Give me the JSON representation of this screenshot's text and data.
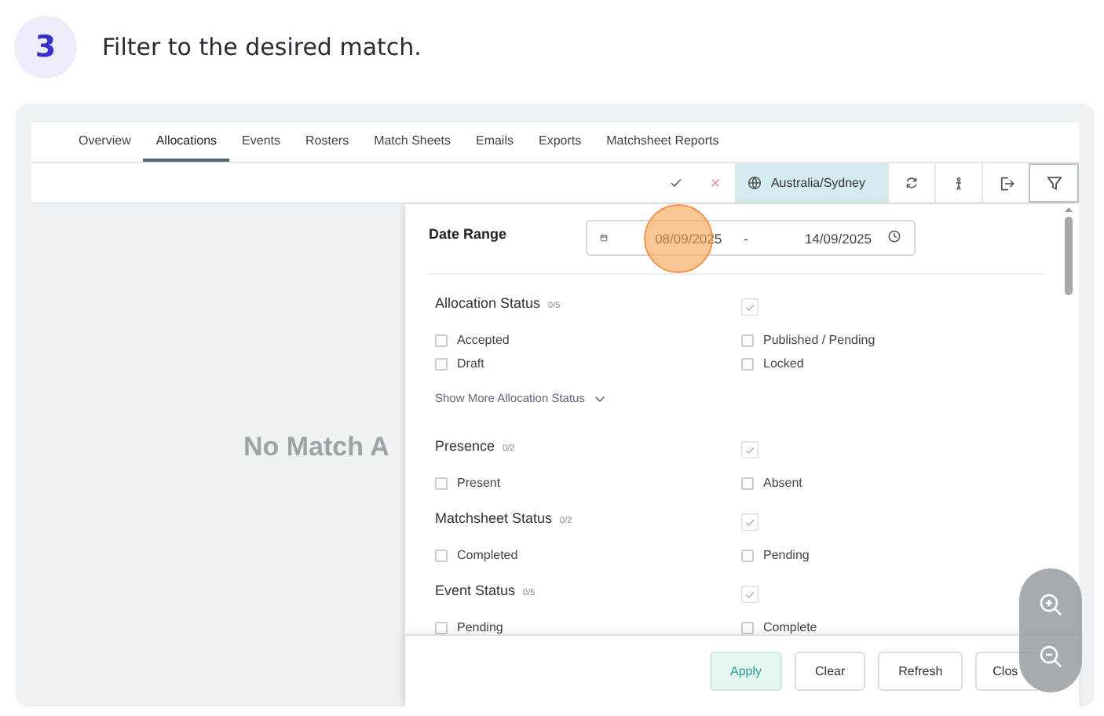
{
  "step": {
    "number": "3",
    "instruction": "Filter to the desired match."
  },
  "tabs": [
    {
      "label": "Overview",
      "selected": false
    },
    {
      "label": "Allocations",
      "selected": true
    },
    {
      "label": "Events",
      "selected": false
    },
    {
      "label": "Rosters",
      "selected": false
    },
    {
      "label": "Match Sheets",
      "selected": false
    },
    {
      "label": "Emails",
      "selected": false
    },
    {
      "label": "Exports",
      "selected": false
    },
    {
      "label": "Matchsheet Reports",
      "selected": false
    }
  ],
  "toolbar": {
    "timezone": "Australia/Sydney",
    "filter_active": true
  },
  "empty_message": "No Match A",
  "filter": {
    "date_range": {
      "label": "Date Range",
      "from": "08/09/2025",
      "separator": "-",
      "to": "14/09/2025"
    },
    "sections": [
      {
        "title": "Allocation Status",
        "count": "0/5",
        "options": [
          {
            "label": "Accepted",
            "checked": false
          },
          {
            "label": "Published / Pending",
            "checked": false
          },
          {
            "label": "Draft",
            "checked": false
          },
          {
            "label": "Locked",
            "checked": false
          }
        ],
        "more_link": "Show More Allocation Status"
      },
      {
        "title": "Presence",
        "count": "0/2",
        "options": [
          {
            "label": "Present",
            "checked": false
          },
          {
            "label": "Absent",
            "checked": false
          }
        ]
      },
      {
        "title": "Matchsheet Status",
        "count": "0/2",
        "options": [
          {
            "label": "Completed",
            "checked": false
          },
          {
            "label": "Pending",
            "checked": false
          }
        ]
      },
      {
        "title": "Event Status",
        "count": "0/5",
        "options": [
          {
            "label": "Pending",
            "checked": false
          },
          {
            "label": "Complete",
            "checked": false
          }
        ]
      }
    ]
  },
  "buttons": [
    {
      "label": "Apply",
      "kind": "primary"
    },
    {
      "label": "Clear",
      "kind": "default"
    },
    {
      "label": "Refresh",
      "kind": "default"
    },
    {
      "label": "Clos",
      "kind": "default"
    }
  ]
}
